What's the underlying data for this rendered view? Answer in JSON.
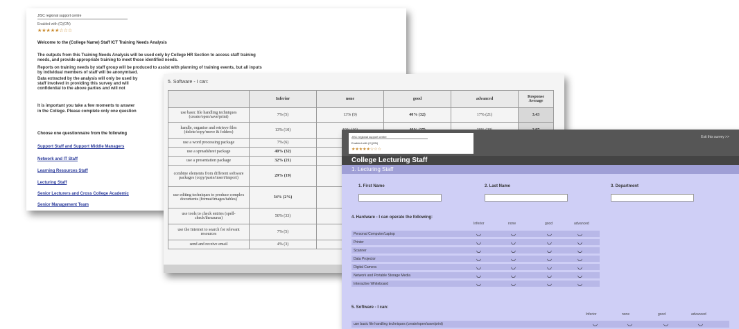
{
  "intro": {
    "org": "JISC regional support centre",
    "sub": "Enabled with (C)(ON)",
    "stars": "★★★★★☆☆☆",
    "welcome": "Welcome to the (College Name) Staff ICT Training Needs Analysis",
    "paragraphs": [
      "The outputs from this Training Needs Analysis will be used only by College HR Section to access staff training",
      "needs, and provide appropriate training to meet those identified needs.",
      "Reports on training needs by staff group will be produced to assist with planning of training events, but all inputs",
      "by individual members of staff will be anonymised.",
      "Data extracted by the analysis will only be used by",
      "staff involved in providing this survey and will",
      "confidential to the above parties and will not",
      "It is important you take a few moments to answer",
      "in the College. Please complete only one question"
    ],
    "choose": "Choose one questionnaire from the following",
    "links": [
      "Support Staff and Support Middle Managers",
      "Network and IT Staff",
      "Learning Resources Staff",
      "Lecturing Staff",
      "Senior Lecturers and Cross College Academic",
      "Senior Management Team"
    ]
  },
  "results": {
    "title": "5. Software - I can:",
    "headers": [
      "",
      "Inferior",
      "none",
      "good",
      "advanced",
      "Response Average"
    ],
    "rows": [
      [
        "use basic file handling techniques (create/open/save/print)",
        "7% (5)",
        "13% (9)",
        "40% (32)",
        "17% (21)",
        "3.43"
      ],
      [
        "handle, organise and retrieve files (delete/copy/move & folders)",
        "13% (10)",
        "19% (10)",
        "40% (27)",
        "30% (20)",
        "2.97"
      ],
      [
        "use a word processing package",
        "7% (6)",
        "",
        "",
        "",
        ""
      ],
      [
        "use a spreadsheet package",
        "40% (32)",
        "",
        "",
        "",
        ""
      ],
      [
        "use a presentation package",
        "32% (21)",
        "",
        "",
        "",
        ""
      ],
      [
        "combine elements from different software packages (copy/paste/insert/import)",
        "29% (19)",
        "",
        "",
        "",
        ""
      ],
      [
        "use editing techniques to produce complex documents (format/images/tables)",
        "34% (2%)",
        "",
        "",
        "",
        ""
      ],
      [
        "use tools to check entries (spell-check/thesaurus)",
        "50% (33)",
        "",
        "",
        "",
        ""
      ],
      [
        "use the Internet to search for relevant resources",
        "7% (5)",
        "",
        "",
        "",
        ""
      ],
      [
        "send and receive email",
        "4% (3)",
        "",
        "",
        "",
        ""
      ]
    ]
  },
  "form": {
    "logo_org": "JISC regional support centre",
    "logo_sub": "Enabled with (C)(ON)",
    "logo_stars": "★★★★★☆☆☆",
    "logout": "Exit this survey >>",
    "title": "College Lecturing Staff",
    "section": "1. Lecturing Staff",
    "fields": [
      "1. First Name",
      "2. Last Name",
      "3. Department"
    ],
    "hardware_title": "4. Hardware - I can operate the following:",
    "levels": [
      "Inferior",
      "none",
      "good",
      "advanced"
    ],
    "hardware_items": [
      "Personal Computer/Laptop",
      "Printer",
      "Scanner",
      "Data Projector",
      "Digital Camera",
      "Network and Portable Storage Media",
      "Interactive Whiteboard"
    ],
    "radio_glyph": "◡",
    "software_title": "5. Software - I can:",
    "software_first": "use basic file handling techniques (create/open/save/print)"
  }
}
